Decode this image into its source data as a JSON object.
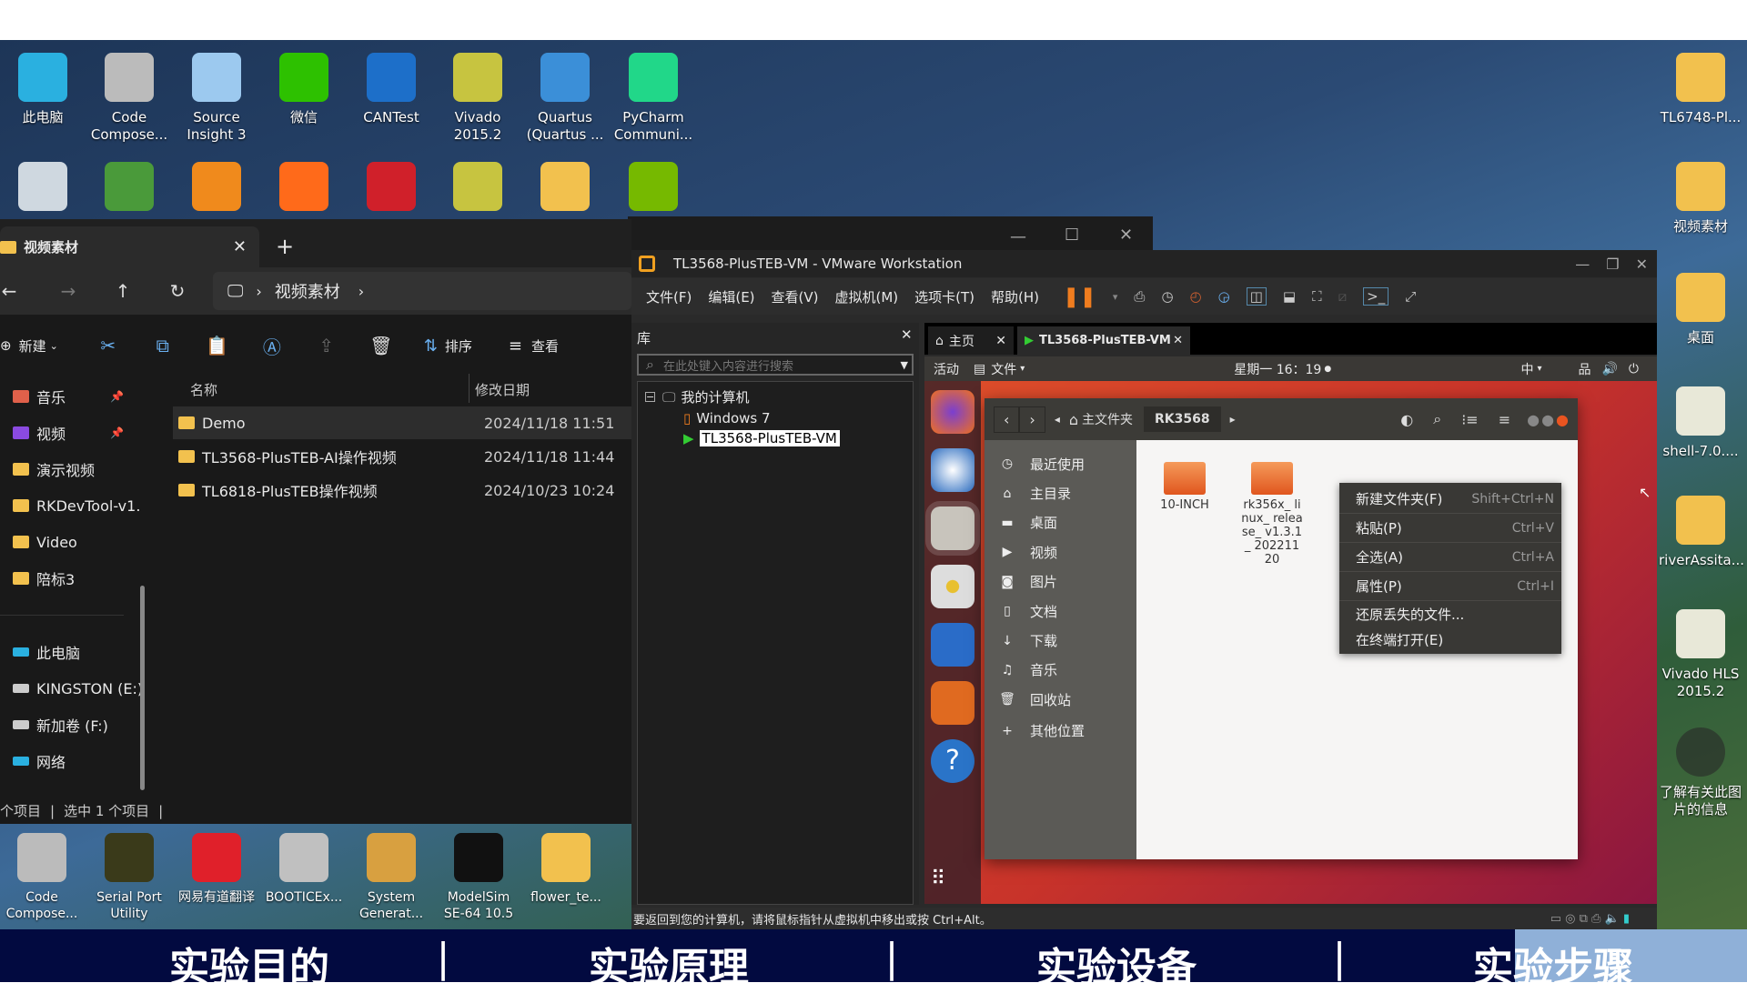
{
  "desktop": {
    "top_icons": [
      {
        "label": "此电脑",
        "icon": "monitor-icon",
        "color": "#2ab0e0"
      },
      {
        "label": "Code Compose...",
        "icon": "cube-icon",
        "color": "#bbbbbb"
      },
      {
        "label": "Source Insight 3",
        "icon": "source-insight-icon",
        "color": "#9cc9ef"
      },
      {
        "label": "微信",
        "icon": "wechat-icon",
        "color": "#2dc100"
      },
      {
        "label": "CANTest",
        "icon": "can-icon",
        "color": "#1d6fc9"
      },
      {
        "label": "Vivado 2015.2",
        "icon": "vivado-icon",
        "color": "#c7c440"
      },
      {
        "label": "Quartus (Quartus ...",
        "icon": "quartus-icon",
        "color": "#3b8fd8"
      },
      {
        "label": "PyCharm Communi...",
        "icon": "pycharm-icon",
        "color": "#21d789"
      }
    ],
    "second_row_colors": [
      "#cfd8e0",
      "#4a9a3a",
      "#f08a1c",
      "#ff6a1a",
      "#d0202a",
      "#c7c440",
      "#f2c14e",
      "#76b900"
    ],
    "right_icons": [
      {
        "label": "TL6748-Pl...",
        "icon": "folder-icon"
      },
      {
        "label": "视频素材",
        "icon": "folder-icon"
      },
      {
        "label": "桌面",
        "icon": "folder-icon"
      },
      {
        "label": "shell-7.0....",
        "icon": "shell-icon"
      },
      {
        "label": "riverAssita...",
        "icon": "zip-folder-icon"
      },
      {
        "label": "Vivado HLS 2015.2",
        "icon": "vivado-hls-icon"
      },
      {
        "label": "了解有关此图片的信息",
        "icon": "picture-info-icon"
      }
    ],
    "bottom_icons": [
      {
        "label": "Code Compose...",
        "color": "#bbbbbb"
      },
      {
        "label": "Serial Port Utility",
        "color": "#3a3a1a"
      },
      {
        "label": "网易有道翻译",
        "color": "#e0202a"
      },
      {
        "label": "BOOTICEx...",
        "color": "#c0c0c0"
      },
      {
        "label": "System Generat...",
        "color": "#d8a040"
      },
      {
        "label": "ModelSim SE-64 10.5",
        "color": "#111111"
      },
      {
        "label": "flower_te...",
        "color": "#f2c14e"
      }
    ]
  },
  "explorer": {
    "tab_title": "视频素材",
    "breadcrumb": "视频素材",
    "toolbar": {
      "new": "新建",
      "sort": "排序",
      "view": "查看"
    },
    "sidebar": [
      {
        "label": "音乐",
        "icon": "music-icon",
        "pinned": true
      },
      {
        "label": "视频",
        "icon": "video-icon",
        "pinned": true
      },
      {
        "label": "演示视频",
        "icon": "folder-icon"
      },
      {
        "label": "RKDevTool-v1.",
        "icon": "folder-icon"
      },
      {
        "label": "Video",
        "icon": "folder-icon"
      },
      {
        "label": "陪标3",
        "icon": "folder-icon"
      }
    ],
    "sidebar_devices": [
      {
        "label": "此电脑",
        "icon": "pc-icon"
      },
      {
        "label": "KINGSTON (E:)",
        "icon": "drive-icon"
      },
      {
        "label": "新加卷 (F:)",
        "icon": "drive-icon"
      },
      {
        "label": "网络",
        "icon": "network-icon"
      }
    ],
    "columns": {
      "name": "名称",
      "date": "修改日期"
    },
    "files": [
      {
        "name": "Demo",
        "date": "2024/11/18 11:51"
      },
      {
        "name": "TL3568-PlusTEB-AI操作视频",
        "date": "2024/11/18 11:44"
      },
      {
        "name": "TL6818-PlusTEB操作视频",
        "date": "2024/10/23 10:24"
      }
    ],
    "status": {
      "items": "个项目",
      "selected": "选中 1 个项目"
    }
  },
  "vmware": {
    "title": "TL3568-PlusTEB-VM - VMware Workstation",
    "menu": [
      "文件(F)",
      "编辑(E)",
      "查看(V)",
      "虚拟机(M)",
      "选项卡(T)",
      "帮助(H)"
    ],
    "library": {
      "title": "库",
      "search_placeholder": "在此处键入内容进行搜索",
      "root": "我的计算机",
      "vms": [
        "Windows 7",
        "TL3568-PlusTEB-VM"
      ]
    },
    "tabs": [
      {
        "label": "主页"
      },
      {
        "label": "TL3568-PlusTEB-VM"
      }
    ],
    "status_text": "要返回到您的计算机，请将鼠标指针从虚拟机中移出或按 Ctrl+Alt。",
    "accent": "#f07d1f"
  },
  "ubuntu": {
    "activities": "活动",
    "app_menu": "文件",
    "clock": "星期一 16：19",
    "input_method": "中",
    "nautilus": {
      "path": [
        "主文件夹",
        "RK3568"
      ],
      "sidebar": [
        {
          "label": "最近使用",
          "icon": "clock-icon"
        },
        {
          "label": "主目录",
          "icon": "home-icon"
        },
        {
          "label": "桌面",
          "icon": "desktop-folder-icon"
        },
        {
          "label": "视频",
          "icon": "video-icon"
        },
        {
          "label": "图片",
          "icon": "camera-icon"
        },
        {
          "label": "文档",
          "icon": "document-icon"
        },
        {
          "label": "下载",
          "icon": "download-icon"
        },
        {
          "label": "音乐",
          "icon": "music-icon"
        },
        {
          "label": "回收站",
          "icon": "trash-icon"
        },
        {
          "label": "其他位置",
          "icon": "plus-icon"
        }
      ],
      "files": [
        "10-INCH",
        "rk356x_ linux_ release_ v1.3.1_ 20221120"
      ]
    },
    "context_menu": [
      {
        "label": "新建文件夹(F)",
        "shortcut": "Shift+Ctrl+N"
      },
      {
        "label": "粘贴(P)",
        "shortcut": "Ctrl+V"
      },
      {
        "label": "全选(A)",
        "shortcut": "Ctrl+A"
      },
      {
        "label": "属性(P)",
        "shortcut": "Ctrl+I"
      },
      {
        "label": "还原丢失的文件...",
        "shortcut": ""
      },
      {
        "label": "在终端打开(E)",
        "shortcut": ""
      }
    ]
  },
  "banner": {
    "items": [
      "实验目的",
      "实验原理",
      "实验设备",
      "实验步骤"
    ],
    "separator": "|",
    "bg": "#020a40",
    "highlight": "#8fb0d8"
  }
}
